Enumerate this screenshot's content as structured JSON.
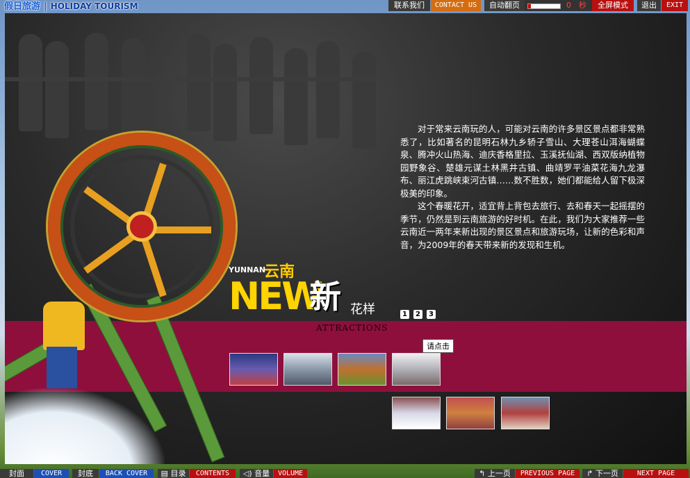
{
  "topbar": {
    "brand_cn": "假日旅游",
    "brand_sep": "|",
    "brand_en": "HOLIDAY TOURISM",
    "contact_cn": "联系我们",
    "contact_en": "CONTACT US",
    "autoflip_cn": "自动翻页",
    "autoflip_value": "0",
    "autoflip_unit": "秒",
    "fullscreen_cn": "全屏模式",
    "exit_cn": "退出",
    "exit_en": "EXIT"
  },
  "article": {
    "paragraphs": [
      "对于常来云南玩的人，可能对云南的许多景区景点都非常熟悉了，比如著名的昆明石林九乡轿子雪山、大理苍山洱海蝴蝶泉、腾冲火山热海、迪庆香格里拉、玉溪抚仙湖、西双版纳植物园野象谷、楚雄元谋土林黑井古镇、曲靖罗平油菜花海九龙瀑布、丽江虎跳峡束河古镇……数不胜数，她们都能给人留下极深极美的印象。",
      "这个春暖花开，适宜背上背包去旅行、去和春天一起摇摆的季节，仍然是到云南旅游的好时机。在此，我们为大家推荐一些云南近一两年来新出现的景区景点和旅游玩场，让新的色彩和声音，为2009年的春天带来新的发现和生机。"
    ]
  },
  "headline": {
    "yunnan_en": "YUNNAN",
    "yunnan_cn": "云南",
    "new_en": "NEW",
    "new_cn": "新",
    "suffix_cn": "花样",
    "section": "ATTRACTIONS"
  },
  "pager": [
    "1",
    "2",
    "3"
  ],
  "tooltip": "请点击",
  "thumbs_row1": [
    {
      "name": "thumb-performance",
      "color": "#4a5aa0"
    },
    {
      "name": "thumb-fountain",
      "color": "#8aa0b0"
    },
    {
      "name": "thumb-temple",
      "color": "#b06020"
    },
    {
      "name": "thumb-monument",
      "color": "#9a9aa0"
    }
  ],
  "thumbs_row2": [
    {
      "name": "thumb-snow-crowd",
      "color": "#c8c8d8"
    },
    {
      "name": "thumb-dancers",
      "color": "#a03030"
    },
    {
      "name": "thumb-festival",
      "color": "#b04040"
    }
  ],
  "bottombar": {
    "cover_cn": "封面",
    "cover_en": "COVER",
    "back_cn": "封底",
    "back_en": "BACK COVER",
    "contents_cn": "目录",
    "contents_en": "CONTENTS",
    "volume_cn": "音量",
    "volume_en": "VOLUME",
    "prev_cn": "上一页",
    "prev_en": "PREVIOUS PAGE",
    "next_cn": "下一页",
    "next_en": "NEXT PAGE"
  },
  "colors": {
    "band": "#8e0f3c",
    "accent_orange": "#d46d12",
    "accent_red": "#b80f0f",
    "accent_blue": "#1c4fb8",
    "title_yellow": "#ffd400"
  }
}
